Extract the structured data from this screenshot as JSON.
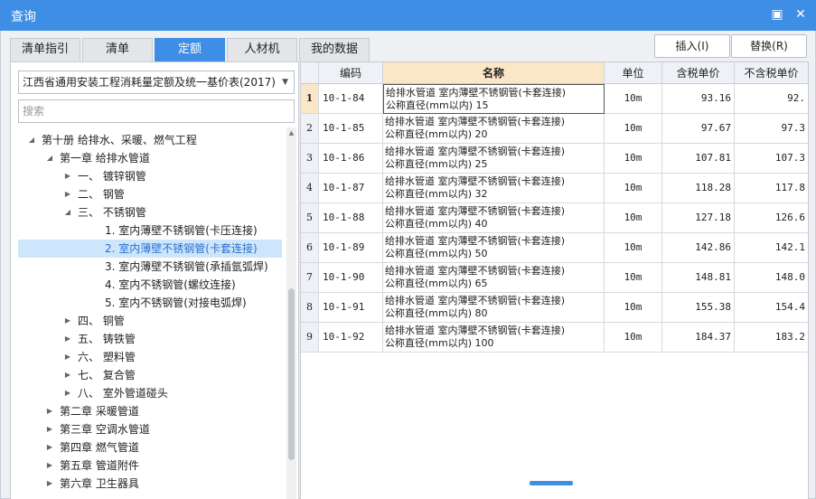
{
  "window": {
    "title": "查询",
    "restore_icon": "restore-icon",
    "close_icon": "close-icon"
  },
  "tabs": [
    "清单指引",
    "清单",
    "定额",
    "人材机",
    "我的数据"
  ],
  "active_tab": 2,
  "actions": {
    "insert": "插入(I)",
    "replace": "替换(R)"
  },
  "left": {
    "combo_value": "江西省通用安装工程消耗量定额及统一基价表(2017)",
    "search_placeholder": "搜索",
    "tree": [
      {
        "label": "第十册 给排水、采暖、燃气工程",
        "level": 0,
        "state": "expanded"
      },
      {
        "label": "第一章 给排水管道",
        "level": 1,
        "state": "expanded"
      },
      {
        "label": "一、 镀锌钢管",
        "level": 2,
        "state": "collapsed"
      },
      {
        "label": "二、 钢管",
        "level": 2,
        "state": "collapsed"
      },
      {
        "label": "三、 不锈钢管",
        "level": 2,
        "state": "expanded"
      },
      {
        "label": "1. 室内薄壁不锈钢管(卡压连接)",
        "level": 3,
        "state": "leaf"
      },
      {
        "label": "2. 室内薄壁不锈钢管(卡套连接)",
        "level": 3,
        "state": "leaf",
        "selected": true
      },
      {
        "label": "3. 室内薄壁不锈钢管(承插氩弧焊)",
        "level": 3,
        "state": "leaf"
      },
      {
        "label": "4. 室内不锈钢管(螺纹连接)",
        "level": 3,
        "state": "leaf"
      },
      {
        "label": "5. 室内不锈钢管(对接电弧焊)",
        "level": 3,
        "state": "leaf"
      },
      {
        "label": "四、 铜管",
        "level": 2,
        "state": "collapsed"
      },
      {
        "label": "五、 铸铁管",
        "level": 2,
        "state": "collapsed"
      },
      {
        "label": "六、 塑料管",
        "level": 2,
        "state": "collapsed"
      },
      {
        "label": "七、 复合管",
        "level": 2,
        "state": "collapsed"
      },
      {
        "label": "八、 室外管道碰头",
        "level": 2,
        "state": "collapsed"
      },
      {
        "label": "第二章 采暖管道",
        "level": 1,
        "state": "collapsed"
      },
      {
        "label": "第三章 空调水管道",
        "level": 1,
        "state": "collapsed"
      },
      {
        "label": "第四章 燃气管道",
        "level": 1,
        "state": "collapsed"
      },
      {
        "label": "第五章 管道附件",
        "level": 1,
        "state": "collapsed"
      },
      {
        "label": "第六章 卫生器具",
        "level": 1,
        "state": "collapsed"
      }
    ]
  },
  "table": {
    "columns": [
      "",
      "编码",
      "名称",
      "单位",
      "含税单价",
      "不含税单价"
    ],
    "highlight_column": 2,
    "active_row": 0,
    "rows": [
      {
        "n": "1",
        "code": "10-1-84",
        "name1": "给排水管道 室内薄壁不锈钢管(卡套连接)",
        "name2": "公称直径(mm以内) 15",
        "unit": "10m",
        "tax": "93.16",
        "notax": "92."
      },
      {
        "n": "2",
        "code": "10-1-85",
        "name1": "给排水管道 室内薄壁不锈钢管(卡套连接)",
        "name2": "公称直径(mm以内) 20",
        "unit": "10m",
        "tax": "97.67",
        "notax": "97.3"
      },
      {
        "n": "3",
        "code": "10-1-86",
        "name1": "给排水管道 室内薄壁不锈钢管(卡套连接)",
        "name2": "公称直径(mm以内) 25",
        "unit": "10m",
        "tax": "107.81",
        "notax": "107.3"
      },
      {
        "n": "4",
        "code": "10-1-87",
        "name1": "给排水管道 室内薄壁不锈钢管(卡套连接)",
        "name2": "公称直径(mm以内) 32",
        "unit": "10m",
        "tax": "118.28",
        "notax": "117.8"
      },
      {
        "n": "5",
        "code": "10-1-88",
        "name1": "给排水管道 室内薄壁不锈钢管(卡套连接)",
        "name2": "公称直径(mm以内) 40",
        "unit": "10m",
        "tax": "127.18",
        "notax": "126.6"
      },
      {
        "n": "6",
        "code": "10-1-89",
        "name1": "给排水管道 室内薄壁不锈钢管(卡套连接)",
        "name2": "公称直径(mm以内) 50",
        "unit": "10m",
        "tax": "142.86",
        "notax": "142.1"
      },
      {
        "n": "7",
        "code": "10-1-90",
        "name1": "给排水管道 室内薄壁不锈钢管(卡套连接)",
        "name2": "公称直径(mm以内) 65",
        "unit": "10m",
        "tax": "148.81",
        "notax": "148.0"
      },
      {
        "n": "8",
        "code": "10-1-91",
        "name1": "给排水管道 室内薄壁不锈钢管(卡套连接)",
        "name2": "公称直径(mm以内) 80",
        "unit": "10m",
        "tax": "155.38",
        "notax": "154.4"
      },
      {
        "n": "9",
        "code": "10-1-92",
        "name1": "给排水管道 室内薄壁不锈钢管(卡套连接)",
        "name2": "公称直径(mm以内) 100",
        "unit": "10m",
        "tax": "184.37",
        "notax": "183.2"
      }
    ]
  }
}
